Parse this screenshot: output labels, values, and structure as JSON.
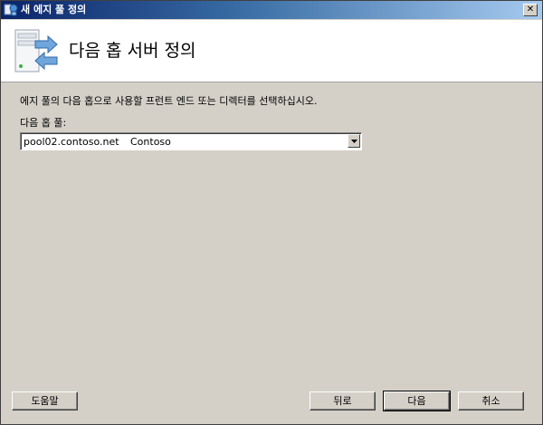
{
  "window": {
    "title": "새 에지 풀 정의",
    "close_glyph": "✕"
  },
  "header": {
    "title": "다음 홉 서버 정의"
  },
  "content": {
    "instruction": "에지 풀의 다음 홉으로 사용할 프런트 엔드 또는 디렉터를 선택하십시오.",
    "pool_label": "다음 홉 풀:",
    "pool_select": {
      "fqdn": "pool02.contoso.net",
      "site": "Contoso"
    }
  },
  "buttons": {
    "help": "도움말",
    "back": "뒤로",
    "next": "다음",
    "cancel": "취소"
  },
  "icons": {
    "window": "wizard-app-icon",
    "header": "server-arrows-icon",
    "dropdown": "chevron-down-icon"
  },
  "colors": {
    "title_bar_start": "#0a246a",
    "title_bar_end": "#a6caf0",
    "dialog_bg": "#d4d0c8",
    "header_bg": "#ffffff"
  }
}
